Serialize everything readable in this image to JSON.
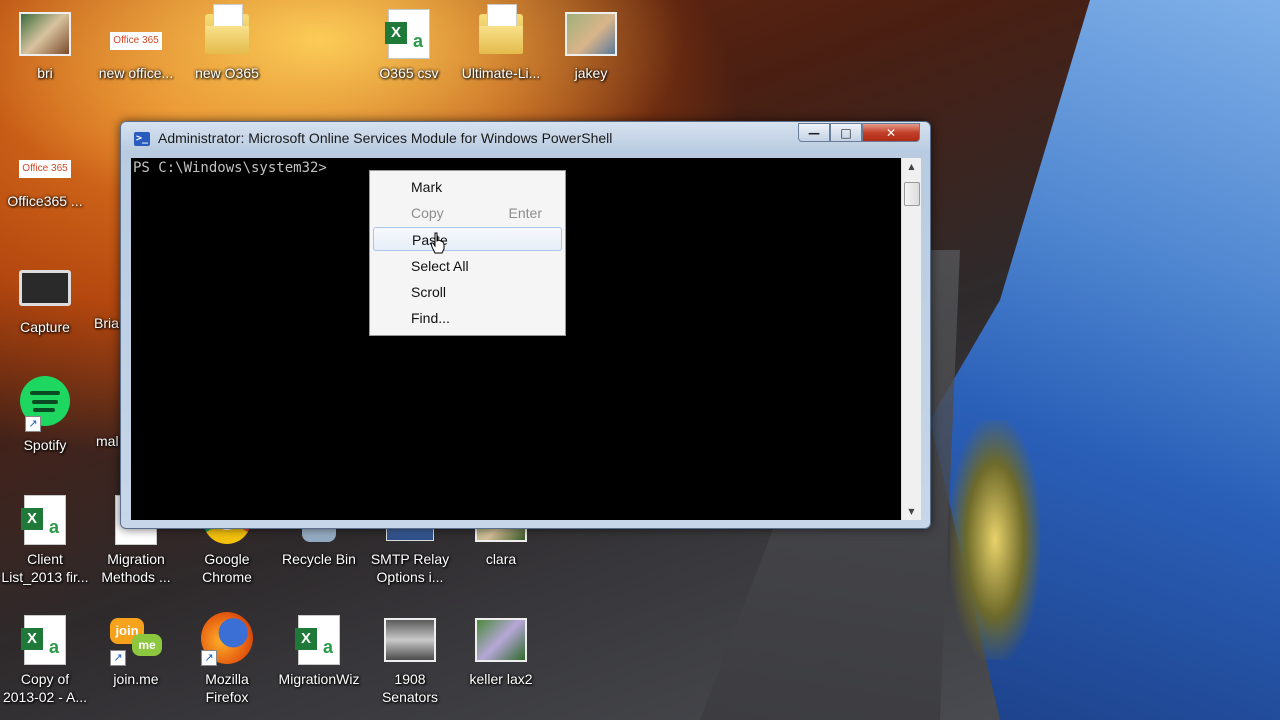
{
  "desktop": {
    "icons": [
      {
        "label": "bri",
        "icon": "photo-icon"
      },
      {
        "label": "new office...",
        "icon": "office365-icon"
      },
      {
        "label": "new O365",
        "icon": "folder-icon"
      },
      {
        "label": "O365 csv",
        "icon": "excel-icon"
      },
      {
        "label": "Ultimate-Li...",
        "icon": "folder-icon"
      },
      {
        "label": "jakey",
        "icon": "photo-icon"
      },
      {
        "label": "Office365 ...",
        "icon": "office365-icon"
      },
      {
        "label": "Capture",
        "icon": "capture-icon"
      },
      {
        "label": "Bria",
        "icon": "photo-icon"
      },
      {
        "label": "Spotify",
        "icon": "spotify-icon"
      },
      {
        "label": "mal",
        "icon": "excel-icon"
      },
      {
        "label": "Client\nList_2013 fir...",
        "icon": "excel-icon"
      },
      {
        "label": "Migration\nMethods ...",
        "icon": "powerpoint-icon"
      },
      {
        "label": "Google\nChrome",
        "icon": "chrome-icon"
      },
      {
        "label": "Recycle Bin",
        "icon": "recycle-bin-icon"
      },
      {
        "label": "SMTP Relay\nOptions i...",
        "icon": "smtp-icon"
      },
      {
        "label": "clara",
        "icon": "photo-icon"
      },
      {
        "label": "Copy of\n2013-02 - A...",
        "icon": "excel-icon"
      },
      {
        "label": "join.me",
        "icon": "joinme-icon"
      },
      {
        "label": "Mozilla\nFirefox",
        "icon": "firefox-icon"
      },
      {
        "label": "MigrationWiz",
        "icon": "excel-icon"
      },
      {
        "label": "1908 Senators",
        "icon": "photo-icon"
      },
      {
        "label": "keller lax2",
        "icon": "photo-icon"
      }
    ]
  },
  "window": {
    "title": "Administrator: Microsoft Online Services Module for Windows PowerShell",
    "icon_text": ">_",
    "minimize": "—",
    "maximize": "□",
    "close": "✕",
    "console_text": "PS C:\\Windows\\system32>"
  },
  "context_menu": {
    "items": [
      {
        "label": "Mark",
        "shortcut": "",
        "enabled": true
      },
      {
        "label": "Copy",
        "shortcut": "Enter",
        "enabled": false
      },
      {
        "label": "Paste",
        "shortcut": "",
        "enabled": true,
        "hovered": true
      },
      {
        "label": "Select All",
        "shortcut": "",
        "enabled": true
      },
      {
        "label": "Scroll",
        "shortcut": "",
        "enabled": true
      },
      {
        "label": "Find...",
        "shortcut": "",
        "enabled": true
      }
    ]
  },
  "office_tile_text": "Office 365",
  "joinme": {
    "top": "join",
    "bottom": "me"
  }
}
